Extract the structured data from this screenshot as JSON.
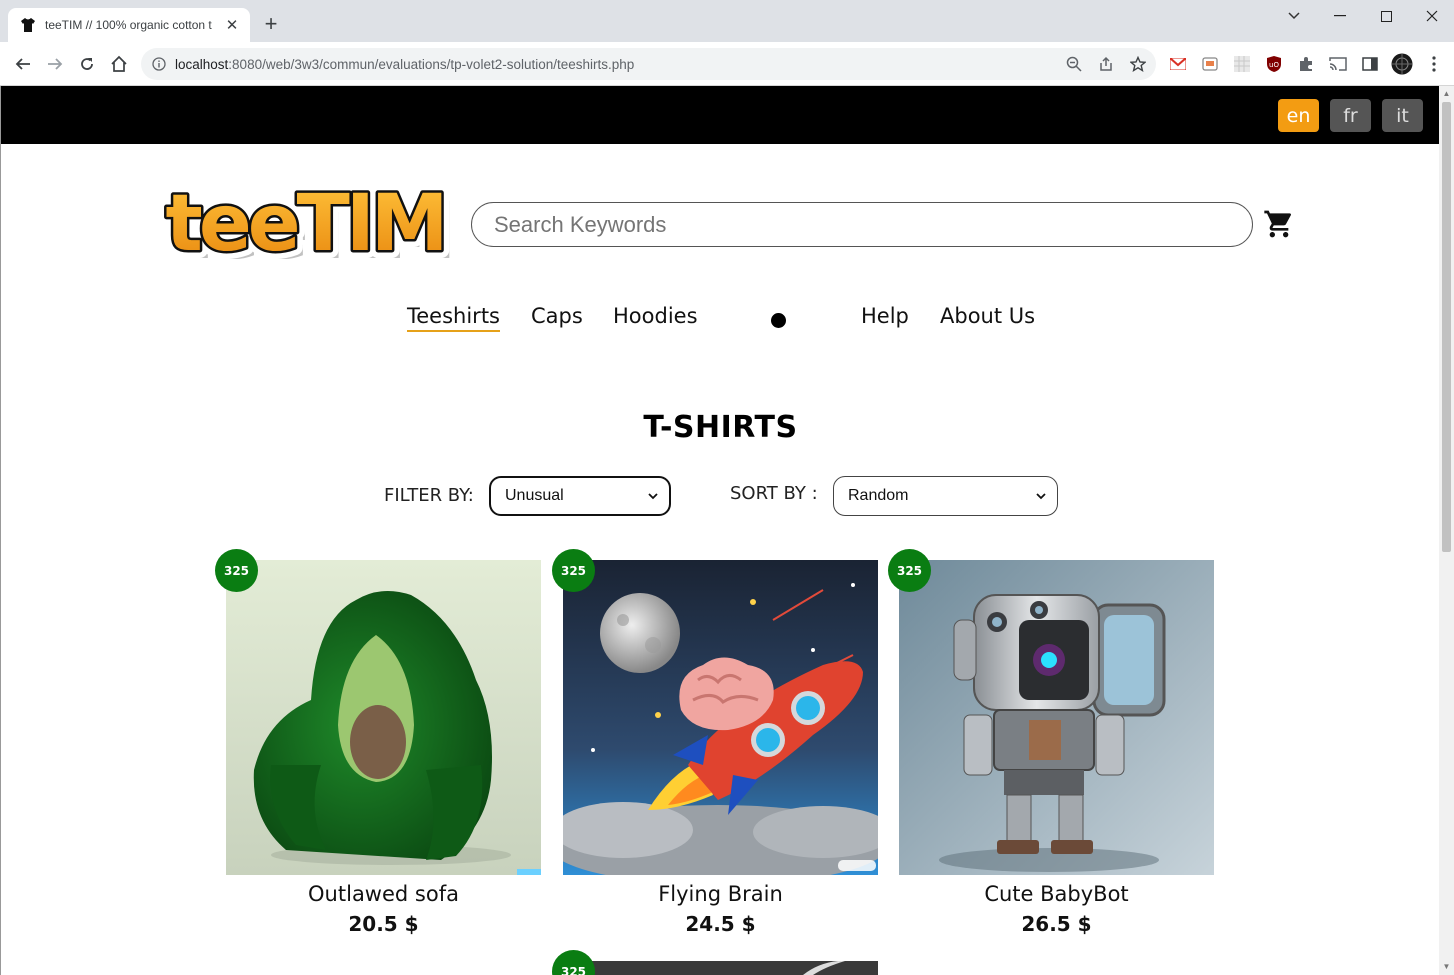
{
  "browser": {
    "tab_title": "teeTIM // 100% organic cotton t",
    "url_host": "localhost",
    "url_rest": ":8080/web/3w3/commun/evaluations/tp-volet2-solution/teeshirts.php"
  },
  "languages": [
    {
      "code": "en",
      "active": true
    },
    {
      "code": "fr",
      "active": false
    },
    {
      "code": "it",
      "active": false
    }
  ],
  "header": {
    "logo_text": "teeTIM",
    "search_placeholder": "Search Keywords"
  },
  "nav": {
    "items": [
      "Teeshirts",
      "Caps",
      "Hoodies",
      "Help",
      "About Us"
    ],
    "active": "Teeshirts"
  },
  "page": {
    "title": "T-SHIRTS",
    "filter_label": "FILTER BY:",
    "filter_value": "Unusual",
    "sort_label": "SORT BY :",
    "sort_value": "Random"
  },
  "products": [
    {
      "name": "Outlawed sofa",
      "price": "20.5 $",
      "badge": "325",
      "image": "avocado-armchair"
    },
    {
      "name": "Flying Brain",
      "price": "24.5 $",
      "badge": "325",
      "image": "brain-rocket"
    },
    {
      "name": "Cute BabyBot",
      "price": "26.5 $",
      "badge": "325",
      "image": "baby-robot"
    }
  ],
  "partial_product": {
    "badge": "325"
  },
  "colors": {
    "accent": "#f39c12",
    "badge": "#0a7d12",
    "topbar": "#000000"
  }
}
